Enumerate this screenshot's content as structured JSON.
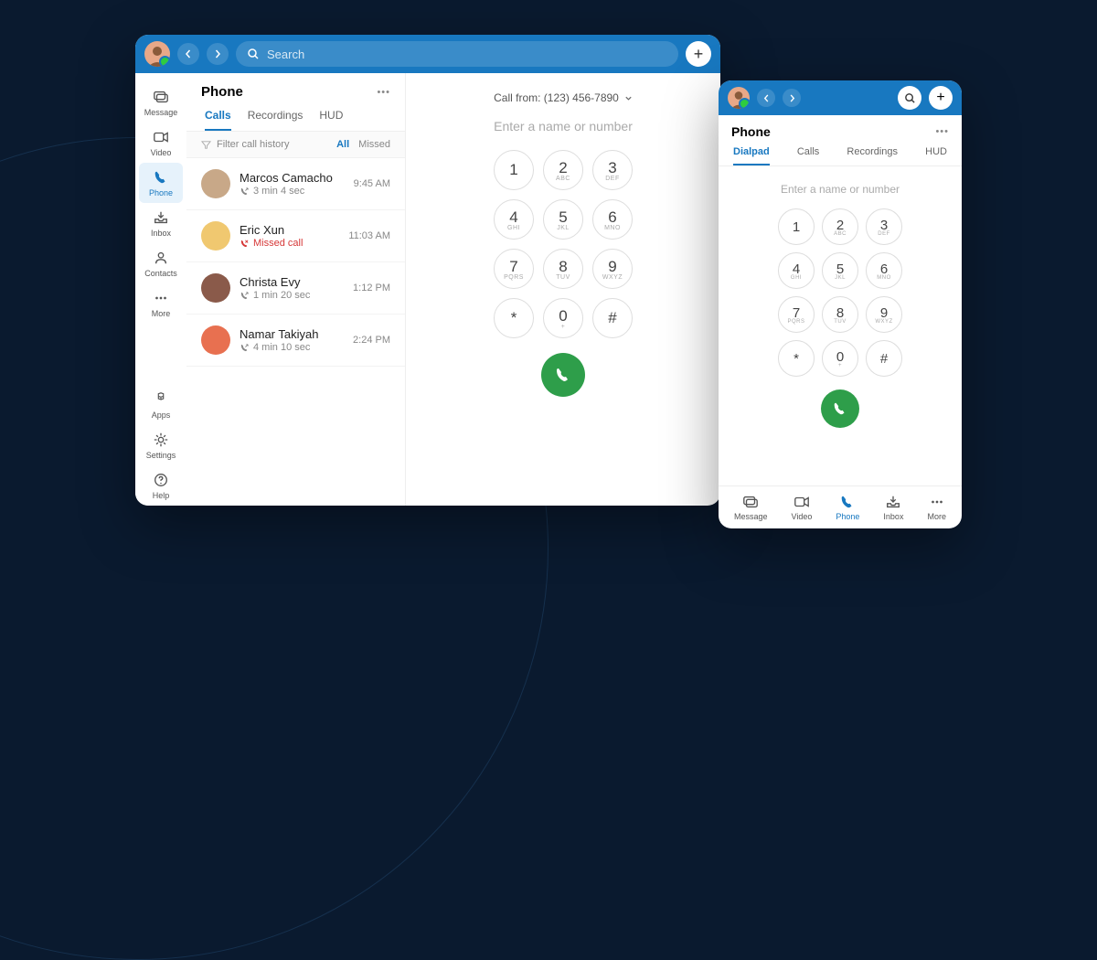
{
  "desktop": {
    "search_placeholder": "Search",
    "sidebar": [
      {
        "label": "Message",
        "name": "message"
      },
      {
        "label": "Video",
        "name": "video"
      },
      {
        "label": "Phone",
        "name": "phone",
        "active": true
      },
      {
        "label": "Inbox",
        "name": "inbox"
      },
      {
        "label": "Contacts",
        "name": "contacts"
      },
      {
        "label": "More",
        "name": "more"
      }
    ],
    "sidebar_bottom": [
      {
        "label": "Apps",
        "name": "apps"
      },
      {
        "label": "Settings",
        "name": "settings"
      },
      {
        "label": "Help",
        "name": "help"
      }
    ],
    "list": {
      "title": "Phone",
      "tabs": [
        "Calls",
        "Recordings",
        "HUD"
      ],
      "active_tab": 0,
      "filter_label": "Filter call history",
      "filters": [
        "All",
        "Missed"
      ],
      "calls": [
        {
          "name": "Marcos Camacho",
          "sub": "3 min 4 sec",
          "time": "9:45 AM",
          "missed": false
        },
        {
          "name": "Eric Xun",
          "sub": "Missed call",
          "time": "11:03 AM",
          "missed": true
        },
        {
          "name": "Christa Evy",
          "sub": "1 min 20 sec",
          "time": "1:12 PM",
          "missed": false
        },
        {
          "name": "Namar Takiyah",
          "sub": "4 min 10 sec",
          "time": "2:24 PM",
          "missed": false
        }
      ]
    },
    "dial": {
      "call_from": "Call from: (123) 456-7890",
      "placeholder": "Enter a name or number"
    }
  },
  "mobile": {
    "title": "Phone",
    "tabs": [
      "Dialpad",
      "Calls",
      "Recordings",
      "HUD"
    ],
    "active_tab": 0,
    "placeholder": "Enter a name or number",
    "bottom": [
      {
        "label": "Message",
        "name": "message"
      },
      {
        "label": "Video",
        "name": "video"
      },
      {
        "label": "Phone",
        "name": "phone",
        "active": true
      },
      {
        "label": "Inbox",
        "name": "inbox"
      },
      {
        "label": "More",
        "name": "more"
      }
    ]
  },
  "keypad": [
    {
      "num": "1",
      "let": ""
    },
    {
      "num": "2",
      "let": "ABC"
    },
    {
      "num": "3",
      "let": "DEF"
    },
    {
      "num": "4",
      "let": "GHI"
    },
    {
      "num": "5",
      "let": "JKL"
    },
    {
      "num": "6",
      "let": "MNO"
    },
    {
      "num": "7",
      "let": "PQRS"
    },
    {
      "num": "8",
      "let": "TUV"
    },
    {
      "num": "9",
      "let": "WXYZ"
    },
    {
      "num": "*",
      "let": ""
    },
    {
      "num": "0",
      "let": "+"
    },
    {
      "num": "#",
      "let": ""
    }
  ]
}
